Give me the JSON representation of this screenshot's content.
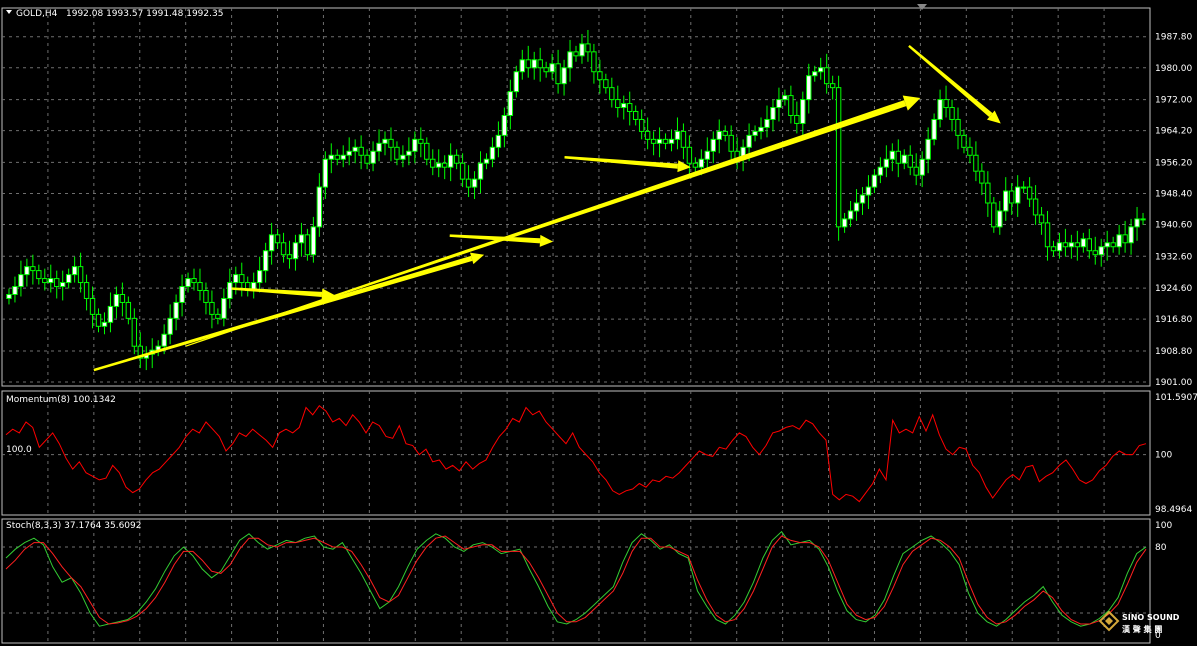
{
  "header": {
    "symbol": "GOLD,H4",
    "ohlc": "1992.08 1993.57 1991.48 1992.35"
  },
  "colors": {
    "background": "#000000",
    "grid": "#6f6f6f",
    "bull_candle": "#ffffff",
    "bear_candle": "#000000",
    "wick": "#00ff00",
    "momentum_line": "#ff0000",
    "stoch_main": "#33cc33",
    "stoch_signal": "#ff2020",
    "arrow": "#ffff00"
  },
  "logo": {
    "line1": "SINO SOUND",
    "line2": "漢 聲 集 團"
  },
  "chart_data": [
    {
      "type": "candlestick",
      "pane": "price",
      "ylim": [
        1901.0,
        1991.0
      ],
      "y_ticks": [
        "1987.80",
        "1980.00",
        "1972.00",
        "1964.20",
        "1956.20",
        "1948.40",
        "1940.60",
        "1932.60",
        "1924.60",
        "1916.80",
        "1908.80",
        "1901.00"
      ],
      "y_tick_values": [
        1987.8,
        1980.0,
        1972.0,
        1964.2,
        1956.2,
        1948.4,
        1940.6,
        1932.6,
        1924.6,
        1916.8,
        1908.8,
        1901.0
      ],
      "closes": [
        1923,
        1925,
        1928,
        1930,
        1929,
        1927,
        1926,
        1927,
        1925,
        1926,
        1928,
        1930,
        1926,
        1922,
        1918,
        1915,
        1916,
        1920,
        1923,
        1921,
        1917,
        1910,
        1907,
        1908,
        1909,
        1910,
        1913,
        1917,
        1921,
        1925,
        1927,
        1926,
        1924,
        1921,
        1918,
        1917,
        1922,
        1926,
        1928,
        1926,
        1924,
        1926,
        1929,
        1934,
        1938,
        1936,
        1933,
        1932,
        1936,
        1938,
        1933,
        1940,
        1950,
        1957,
        1958,
        1957,
        1958,
        1959,
        1960,
        1958,
        1956,
        1959,
        1961,
        1962,
        1960,
        1957,
        1958,
        1959,
        1962,
        1961,
        1957,
        1955,
        1956,
        1955,
        1958,
        1956,
        1952,
        1950,
        1952,
        1956,
        1957,
        1960,
        1963,
        1968,
        1974,
        1979,
        1982,
        1980,
        1982,
        1980,
        1979,
        1981,
        1976,
        1980,
        1984,
        1983,
        1986,
        1984,
        1979,
        1977,
        1975,
        1972,
        1970,
        1971,
        1969,
        1967,
        1964,
        1962,
        1961,
        1962,
        1961,
        1962,
        1964,
        1960,
        1956,
        1955,
        1957,
        1959,
        1962,
        1964,
        1963,
        1959,
        1957,
        1960,
        1963,
        1964,
        1965,
        1967,
        1970,
        1972,
        1973,
        1968,
        1966,
        1972,
        1978,
        1979,
        1980,
        1976,
        1975,
        1940,
        1942,
        1944,
        1946,
        1948,
        1950,
        1953,
        1955,
        1957,
        1959,
        1956,
        1958,
        1955,
        1953,
        1957,
        1962,
        1967,
        1972,
        1970,
        1967,
        1963,
        1960,
        1958,
        1954,
        1951,
        1946,
        1940,
        1944,
        1949,
        1946,
        1950,
        1950,
        1947,
        1943,
        1941,
        1935,
        1934,
        1936,
        1935,
        1936,
        1935,
        1937,
        1934,
        1933,
        1935,
        1936,
        1935,
        1938,
        1936,
        1940,
        1942,
        1942
      ],
      "annotations": [
        {
          "type": "arrow",
          "from": [
            4,
            1904
          ],
          "to": [
            21,
            1933
          ]
        },
        {
          "type": "arrow",
          "from": [
            10,
            1924.5
          ],
          "to": [
            14.5,
            1922.8
          ]
        },
        {
          "type": "arrow",
          "from": [
            19.5,
            1937.8
          ],
          "to": [
            24,
            1936.3
          ]
        },
        {
          "type": "arrow",
          "from": [
            24.5,
            1957.5
          ],
          "to": [
            30,
            1955.0
          ]
        },
        {
          "type": "arrow",
          "from": [
            39.5,
            1985.5
          ],
          "to": [
            43.5,
            1966.0
          ]
        },
        {
          "type": "arrow",
          "from": [
            8,
            1910
          ],
          "to": [
            40,
            1972.4
          ]
        }
      ]
    },
    {
      "type": "line",
      "pane": "momentum",
      "label": "Momentum(8) 100.1342",
      "ylim": [
        98.4964,
        101.5907
      ],
      "y_ticks": [
        "101.5907",
        "100",
        "98.4964"
      ],
      "y_tick_values": [
        101.5907,
        100,
        98.4964
      ],
      "level_label": "100.0",
      "series": [
        {
          "name": "Momentum(8)",
          "values": [
            100.55,
            100.7,
            100.6,
            100.9,
            100.75,
            100.2,
            100.4,
            100.6,
            100.3,
            99.9,
            99.6,
            99.8,
            99.5,
            99.4,
            99.3,
            99.35,
            99.7,
            99.5,
            99.1,
            98.95,
            99.05,
            99.3,
            99.5,
            99.6,
            99.8,
            100.0,
            100.2,
            100.5,
            100.7,
            100.6,
            100.9,
            100.7,
            100.5,
            100.1,
            100.3,
            100.6,
            100.5,
            100.7,
            100.55,
            100.4,
            100.2,
            100.6,
            100.7,
            100.6,
            100.75,
            101.3,
            101.1,
            101.35,
            101.2,
            100.9,
            101.0,
            100.8,
            101.1,
            100.9,
            100.6,
            100.9,
            100.8,
            100.5,
            100.45,
            100.8,
            100.3,
            100.25,
            100.0,
            100.15,
            99.8,
            99.85,
            99.6,
            99.7,
            99.55,
            99.8,
            99.6,
            99.75,
            99.85,
            100.2,
            100.5,
            100.7,
            101.0,
            100.9,
            101.3,
            101.1,
            101.2,
            100.9,
            100.7,
            100.5,
            100.3,
            100.6,
            100.2,
            100.0,
            99.8,
            99.5,
            99.3,
            99.0,
            98.9,
            99.0,
            99.05,
            99.2,
            99.1,
            99.3,
            99.25,
            99.4,
            99.35,
            99.5,
            99.7,
            99.9,
            100.1,
            100.0,
            99.95,
            100.2,
            100.15,
            100.4,
            100.6,
            100.5,
            100.2,
            100.0,
            100.25,
            100.6,
            100.65,
            100.75,
            100.8,
            100.7,
            100.95,
            100.85,
            100.6,
            100.4,
            98.9,
            98.75,
            98.9,
            98.85,
            98.7,
            98.95,
            99.2,
            99.6,
            99.3,
            100.95,
            100.6,
            100.7,
            100.6,
            101.05,
            100.65,
            101.1,
            100.55,
            100.15,
            100.0,
            100.2,
            100.15,
            99.7,
            99.5,
            99.1,
            98.8,
            99.05,
            99.3,
            99.45,
            99.3,
            99.65,
            99.7,
            99.25,
            99.4,
            99.5,
            99.7,
            99.85,
            99.6,
            99.3,
            99.2,
            99.3,
            99.55,
            99.7,
            99.95,
            100.1,
            100.0,
            100.0,
            100.25,
            100.3
          ]
        }
      ]
    },
    {
      "type": "line",
      "pane": "stochastic",
      "label": "Stoch(8,3,3) 37.1764 35.6092",
      "ylim": [
        0,
        100
      ],
      "y_ticks": [
        "100",
        "80",
        "0"
      ],
      "y_tick_values": [
        100,
        80,
        0
      ],
      "series": [
        {
          "name": "Stoch main",
          "values": [
            70,
            78,
            84,
            88,
            82,
            62,
            48,
            52,
            38,
            20,
            8,
            10,
            12,
            14,
            20,
            30,
            42,
            58,
            72,
            80,
            72,
            60,
            52,
            58,
            72,
            86,
            92,
            84,
            78,
            82,
            86,
            84,
            88,
            90,
            80,
            78,
            84,
            70,
            56,
            40,
            24,
            30,
            44,
            62,
            78,
            86,
            92,
            88,
            80,
            76,
            82,
            84,
            80,
            74,
            76,
            78,
            60,
            44,
            26,
            12,
            10,
            14,
            20,
            28,
            36,
            44,
            66,
            84,
            92,
            86,
            78,
            82,
            74,
            70,
            40,
            26,
            14,
            10,
            18,
            30,
            48,
            70,
            86,
            94,
            82,
            84,
            86,
            78,
            62,
            40,
            22,
            14,
            12,
            18,
            32,
            54,
            74,
            80,
            86,
            90,
            84,
            76,
            64,
            38,
            20,
            12,
            8,
            14,
            22,
            30,
            36,
            44,
            30,
            18,
            12,
            8,
            10,
            15,
            22,
            34,
            56,
            74,
            80
          ],
          "note": ""
        },
        {
          "name": "Stoch signal",
          "values": [
            60,
            68,
            78,
            84,
            84,
            74,
            62,
            52,
            44,
            30,
            16,
            10,
            11,
            13,
            17,
            24,
            34,
            48,
            64,
            76,
            76,
            68,
            58,
            56,
            64,
            78,
            88,
            88,
            82,
            80,
            84,
            84,
            86,
            88,
            84,
            80,
            80,
            76,
            64,
            50,
            34,
            30,
            36,
            52,
            68,
            80,
            88,
            90,
            84,
            78,
            80,
            82,
            82,
            76,
            76,
            76,
            66,
            52,
            36,
            20,
            12,
            12,
            16,
            24,
            32,
            40,
            56,
            76,
            88,
            88,
            80,
            80,
            76,
            72,
            50,
            32,
            18,
            12,
            14,
            24,
            40,
            60,
            80,
            90,
            86,
            84,
            84,
            80,
            68,
            48,
            28,
            18,
            14,
            16,
            26,
            44,
            64,
            76,
            82,
            88,
            86,
            80,
            70,
            48,
            28,
            16,
            10,
            12,
            18,
            26,
            32,
            40,
            34,
            22,
            14,
            10,
            10,
            13,
            19,
            28,
            46,
            66,
            78
          ]
        }
      ]
    }
  ]
}
